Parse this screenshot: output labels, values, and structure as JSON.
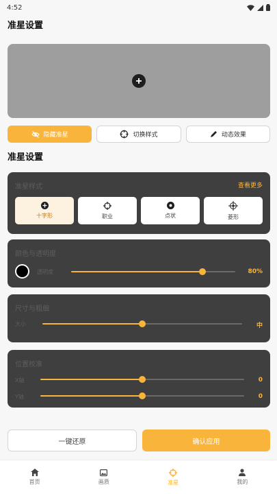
{
  "status": {
    "time": "4:52"
  },
  "page_title": "准星设置",
  "toolbar": {
    "hide_label": "隐藏准星",
    "switch_label": "切换样式",
    "dynamic_label": "动态效果"
  },
  "section_title": "准星设置",
  "style_card": {
    "title": "准星样式",
    "more_label": "查看更多",
    "options": [
      {
        "label": "十字形"
      },
      {
        "label": "职业"
      },
      {
        "label": "点状"
      },
      {
        "label": "菱形"
      }
    ],
    "selected_index": 0
  },
  "color_card": {
    "title": "颜色与透明度",
    "swatch_color": "#000000",
    "opacity_label": "透明度",
    "opacity_value": 0.8,
    "opacity_display": "80%"
  },
  "size_card": {
    "title": "尺寸与粗细",
    "size_label": "大小",
    "size_value": 0.5,
    "size_display": "中"
  },
  "position_card": {
    "title": "位置校准",
    "x_label": "X轴",
    "x_value": 0.5,
    "x_display": "0",
    "y_label": "Y轴",
    "y_value": 0.5,
    "y_display": "0"
  },
  "actions": {
    "reset_label": "一键还原",
    "confirm_label": "确认应用"
  },
  "tabs": [
    {
      "label": "首页",
      "icon": "home-icon"
    },
    {
      "label": "画质",
      "icon": "image-icon"
    },
    {
      "label": "准星",
      "icon": "crosshair-icon"
    },
    {
      "label": "我的",
      "icon": "user-icon"
    }
  ],
  "active_tab": 2,
  "colors": {
    "accent": "#f9b43c",
    "card": "#3f3f3f",
    "preview": "#9e9e9e"
  }
}
